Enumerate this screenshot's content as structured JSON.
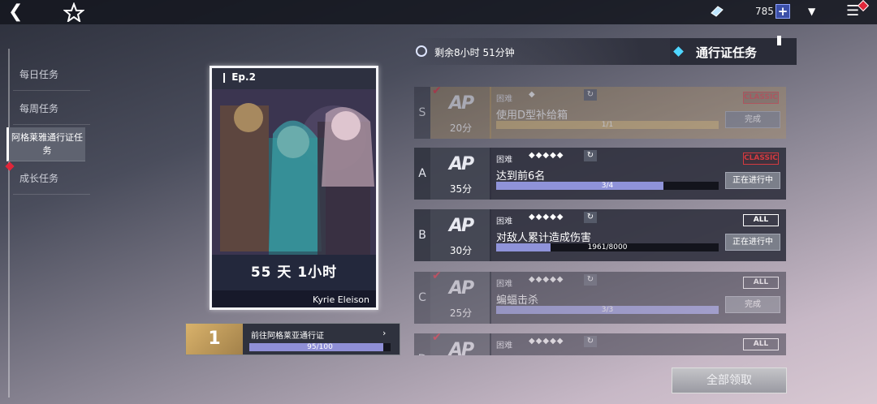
{
  "topbar": {
    "back_icon": "back-arrow-icon",
    "home_icon": "star-emblem-icon",
    "currency_icon": "crystal-icon",
    "currency_count": "785",
    "add_label": "+",
    "dropdown_icon": "triangle-down-icon",
    "menu_icon": "hamburger-icon",
    "notification_color": "#e0263a"
  },
  "sidebar": {
    "items": [
      {
        "label": "每日任务"
      },
      {
        "label": "每周任务"
      },
      {
        "label": "阿格莱雅通行证任务"
      },
      {
        "label": "成长任务"
      }
    ]
  },
  "card": {
    "episode": "Ep.2",
    "time_left": "55 天 1小时",
    "name": "Kyrie Eleison"
  },
  "level": {
    "number": "1",
    "label": "前往阿格莱亚通行证",
    "progress": "95/100",
    "fraction": 0.95
  },
  "timer": {
    "text": "剩余8小时 51分钟"
  },
  "pass": {
    "title": "通行证任务"
  },
  "missions": [
    {
      "rank": "S",
      "points": "20分",
      "difficulty": "困难",
      "stars": "◆",
      "name": "使用D型补给箱",
      "progress": "1/1",
      "fraction": 1.0,
      "tag": "CLASSIC",
      "button": "完成",
      "done": true
    },
    {
      "rank": "A",
      "points": "35分",
      "difficulty": "困难",
      "stars": "◆◆◆◆◆",
      "name": "达到前6名",
      "progress": "3/4",
      "fraction": 0.75,
      "tag": "CLASSIC",
      "button": "正在进行中",
      "done": false
    },
    {
      "rank": "B",
      "points": "30分",
      "difficulty": "困难",
      "stars": "◆◆◆◆◆",
      "name": "对敌人累计造成伤害",
      "progress": "1961/8000",
      "fraction": 0.245,
      "tag": "ALL",
      "button": "正在进行中",
      "done": false
    },
    {
      "rank": "C",
      "points": "25分",
      "difficulty": "困难",
      "stars": "◆◆◆◆◆",
      "name": "蝙蝠击杀",
      "progress": "3/3",
      "fraction": 1.0,
      "tag": "ALL",
      "button": "完成",
      "done": true
    },
    {
      "rank": "D",
      "points": "",
      "difficulty": "困难",
      "stars": "◆◆◆◆◆",
      "name": "",
      "progress": "",
      "fraction": 0,
      "tag": "ALL",
      "button": "",
      "done": true
    }
  ],
  "mission_logo": "AP",
  "claim_all": "全部领取"
}
